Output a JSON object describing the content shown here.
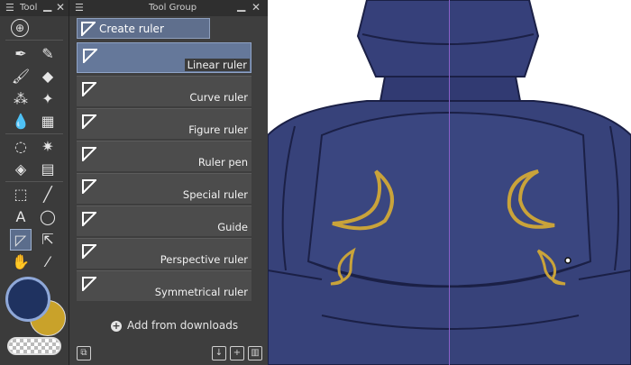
{
  "tool_panel": {
    "title": "Tool",
    "menu_icon": "hamburger-icon",
    "min_glyph": "▁",
    "close_glyph": "✕",
    "tools": [
      {
        "name": "download-icon",
        "glyph": "⊕"
      },
      {
        "name": "pen-icon",
        "glyph": "✒"
      },
      {
        "name": "pencil-icon",
        "glyph": "✎"
      },
      {
        "name": "brush-icon",
        "glyph": "🖌"
      },
      {
        "name": "eraser-icon",
        "glyph": "◆"
      },
      {
        "name": "airbrush-icon",
        "glyph": "⁂"
      },
      {
        "name": "decoration-icon",
        "glyph": "✦"
      },
      {
        "name": "blend-icon",
        "glyph": "💧"
      },
      {
        "name": "grid-icon",
        "glyph": "▦"
      },
      {
        "name": "lasso-icon",
        "glyph": "◌"
      },
      {
        "name": "magic-wand-icon",
        "glyph": "✷"
      },
      {
        "name": "fill-icon",
        "glyph": "◈"
      },
      {
        "name": "gradient-icon",
        "glyph": "▤"
      },
      {
        "name": "object-icon",
        "glyph": "⬚"
      },
      {
        "name": "line-icon",
        "glyph": "╱"
      },
      {
        "name": "text-icon",
        "glyph": "A"
      },
      {
        "name": "balloon-icon",
        "glyph": "◯"
      },
      {
        "name": "ruler-icon",
        "glyph": "◸"
      },
      {
        "name": "move-icon",
        "glyph": "⇱"
      },
      {
        "name": "hand-icon",
        "glyph": "✋"
      },
      {
        "name": "eyedropper-icon",
        "glyph": "⁄"
      }
    ],
    "colors": {
      "main": "#1f3260",
      "sub": "#c9a22a"
    }
  },
  "group_panel": {
    "title": "Tool Group",
    "min_glyph": "▁",
    "close_glyph": "✕",
    "create_button": "Create ruler",
    "items": [
      {
        "label": "Linear ruler",
        "selected": true
      },
      {
        "label": "Curve ruler",
        "selected": false
      },
      {
        "label": "Figure ruler",
        "selected": false
      },
      {
        "label": "Ruler pen",
        "selected": false
      },
      {
        "label": "Special ruler",
        "selected": false
      },
      {
        "label": "Guide",
        "selected": false
      },
      {
        "label": "Perspective ruler",
        "selected": false
      },
      {
        "label": "Symmetrical ruler",
        "selected": false
      }
    ],
    "add_downloads": "Add from downloads",
    "footer_icons": [
      "group-settings-icon",
      "import-icon",
      "duplicate-icon",
      "trash-icon"
    ]
  },
  "canvas": {
    "armor_color": "#37427a",
    "moon_color": "#c9a33a",
    "guide_color": "#8a60c8"
  }
}
